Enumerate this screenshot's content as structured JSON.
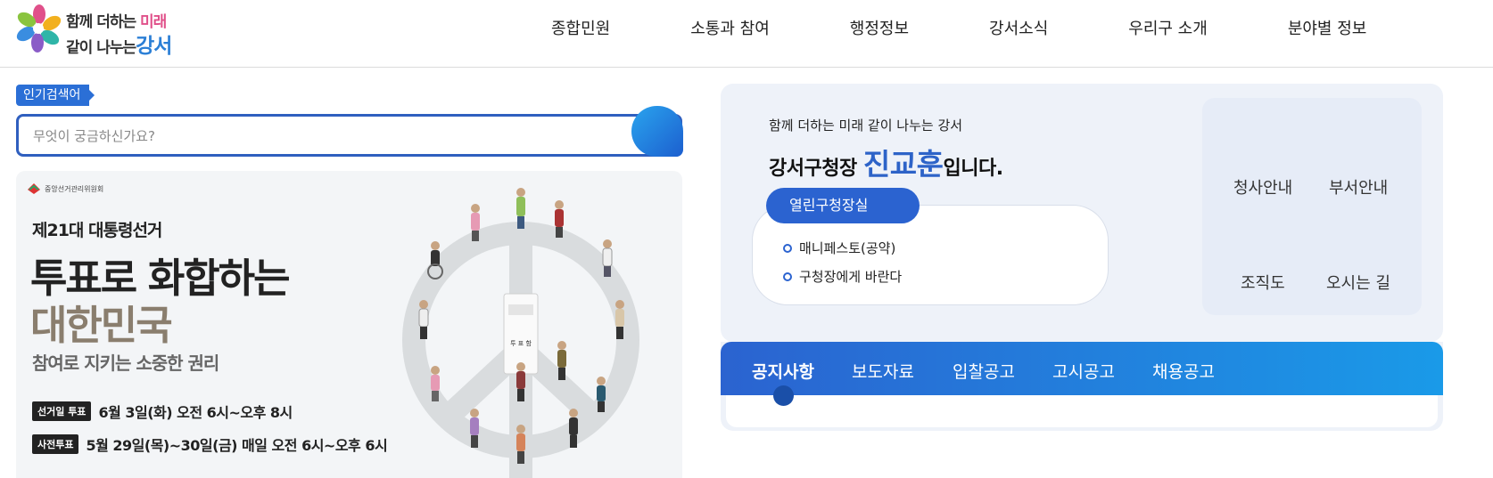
{
  "header": {
    "logo": {
      "line1": "함께 더하는",
      "line1_accent": "미래",
      "line2": "같이 나누는",
      "line2_accent": "강서"
    },
    "nav": [
      {
        "label": "종합민원"
      },
      {
        "label": "소통과 참여"
      },
      {
        "label": "행정정보"
      },
      {
        "label": "강서소식"
      },
      {
        "label": "우리구 소개"
      },
      {
        "label": "분야별 정보"
      }
    ]
  },
  "search": {
    "popular_label": "인기검색어",
    "placeholder": "무엇이 궁금하신가요?"
  },
  "banner": {
    "org": "중앙선거관리위원회",
    "subtitle": "제21대 대통령선거",
    "title_line1": "투표로 화합하는",
    "title_line2": "대한민국",
    "description": "참여로 지키는 소중한 권리",
    "election_tag": "선거일 투표",
    "election_text": "6월 3일(화) 오전 6시~오후 8시",
    "early_tag": "사전투표",
    "early_text": "5월 29일(목)~30일(금) 매일 오전 6시~오후 6시",
    "ballot_box_text": "투 표 함"
  },
  "mayor": {
    "slogan": "함께 더하는 미래 같이 나누는 강서",
    "intro_prefix": "강서구청장 ",
    "name": "진교훈",
    "intro_suffix": "입니다.",
    "open_room_label": "열린구청장실",
    "links": [
      {
        "label": "매니페스토(공약)"
      },
      {
        "label": "구청장에게 바란다"
      }
    ]
  },
  "quick_links": [
    {
      "label": "청사안내"
    },
    {
      "label": "부서안내"
    },
    {
      "label": "조직도"
    },
    {
      "label": "오시는 길"
    }
  ],
  "notice": {
    "tabs": [
      {
        "label": "공지사항",
        "active": true
      },
      {
        "label": "보도자료"
      },
      {
        "label": "입찰공고"
      },
      {
        "label": "고시공고"
      },
      {
        "label": "채용공고"
      }
    ]
  },
  "colors": {
    "primary": "#2b63d0",
    "accent_pink": "#e0508a",
    "banner_title_brown": "#8a7e6e"
  }
}
